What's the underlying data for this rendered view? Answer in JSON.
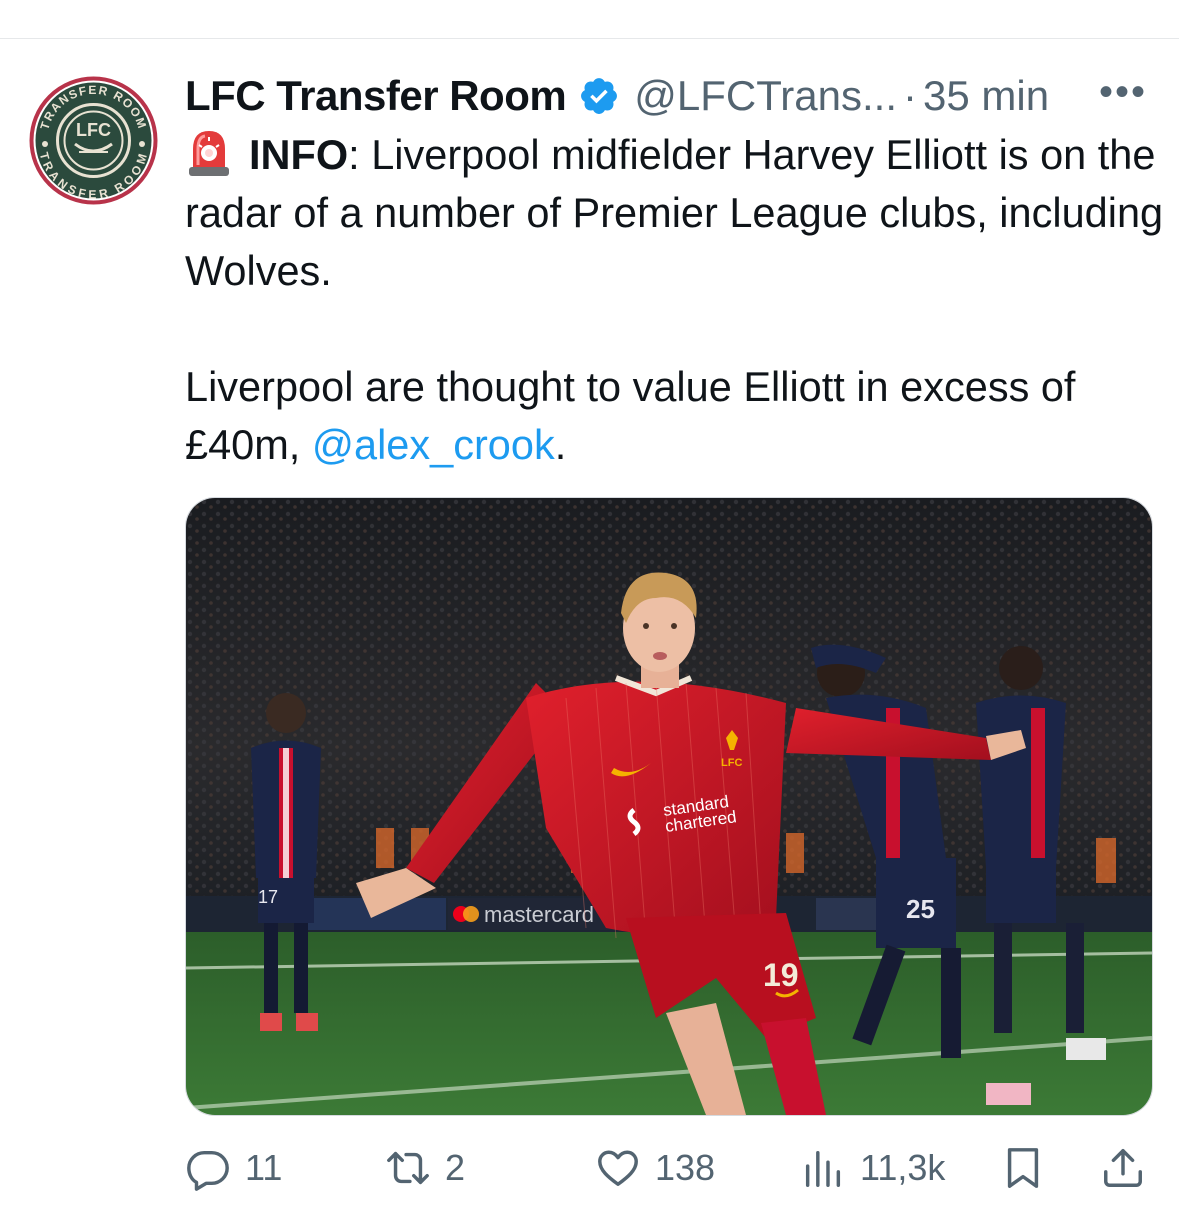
{
  "tweet": {
    "author_name": "LFC Transfer Room",
    "handle": "@LFCTrans...",
    "separator": "·",
    "time": "35 min",
    "more_label": "•••",
    "avatar_text_top": "TRANSFER ROOM",
    "avatar_text_bottom": "TRANSFER ROOM",
    "avatar_monogram": "LFC",
    "info_label": "INFO",
    "line1_rest": ": Liverpool midfielder Harvey Elliott is on the radar of a number of Premier League clubs, including Wolves.",
    "para2_text": "Liverpool are thought to value Elliott in excess of £40m, ",
    "mention": "@alex_crook",
    "para2_end": ".",
    "image_texts": {
      "board_brand": "mastercard",
      "shirt_sponsor_line1": "standard",
      "shirt_sponsor_line2": "chartered",
      "shirt_number": "19",
      "opponent_number_1": "17",
      "opponent_number_2": "25",
      "crest_text": "LFC"
    }
  },
  "actions": {
    "reply_count": "11",
    "retweet_count": "2",
    "like_count": "138",
    "views_count": "11,3k"
  },
  "colors": {
    "accent": "#1d9bf0",
    "secondary_text": "#536471",
    "avatar_green": "#2b4a3d",
    "avatar_ring": "#b8334a",
    "liverpool_red": "#c8102e",
    "psg_navy": "#1b2547",
    "pitch_green": "#2f6a2c"
  },
  "icons": [
    "verified-badge-icon",
    "siren-emoji-icon",
    "more-icon",
    "reply-icon",
    "retweet-icon",
    "like-icon",
    "views-icon",
    "bookmark-icon",
    "share-icon"
  ]
}
